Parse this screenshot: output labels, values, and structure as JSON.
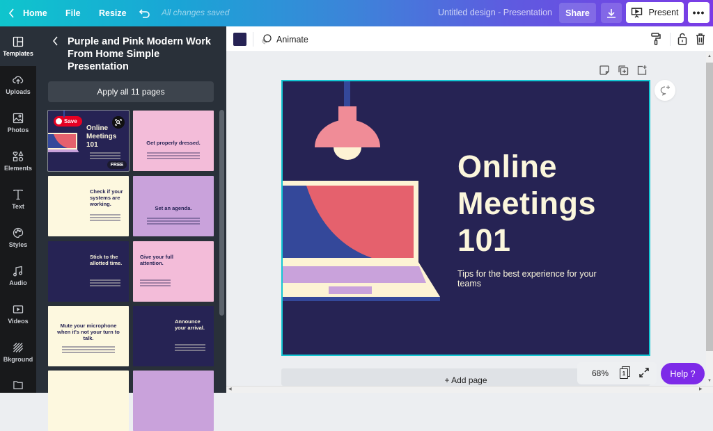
{
  "topbar": {
    "home_label": "Home",
    "file_label": "File",
    "resize_label": "Resize",
    "save_status": "All changes saved",
    "document_title": "Untitled design - Presentation",
    "share_label": "Share",
    "present_label": "Present",
    "more_label": "•••"
  },
  "rail": {
    "items": [
      {
        "label": "Templates",
        "icon": "templates-icon",
        "active": true
      },
      {
        "label": "Uploads",
        "icon": "cloud-upload-icon"
      },
      {
        "label": "Photos",
        "icon": "image-icon"
      },
      {
        "label": "Elements",
        "icon": "shapes-icon"
      },
      {
        "label": "Text",
        "icon": "text-icon"
      },
      {
        "label": "Styles",
        "icon": "palette-icon"
      },
      {
        "label": "Audio",
        "icon": "music-note-icon"
      },
      {
        "label": "Videos",
        "icon": "video-icon"
      },
      {
        "label": "Bkground",
        "icon": "background-pattern-icon"
      },
      {
        "label": "",
        "icon": "folder-icon"
      }
    ]
  },
  "panel": {
    "title": "Purple and Pink Modern Work From Home Simple Presentation",
    "apply_label": "Apply all 11 pages",
    "save_badge": "Save",
    "free_badge": "FREE",
    "thumbnails": [
      {
        "title": "Online Meetings 101",
        "bg": "#262354",
        "fg": "#fbf6dc"
      },
      {
        "title": "Get properly dressed.",
        "bg": "#f3bcd9",
        "fg": "#262354"
      },
      {
        "title": "Check if your systems are working.",
        "bg": "#fdf8df",
        "fg": "#262354"
      },
      {
        "title": "Set an agenda.",
        "bg": "#c9a2db",
        "fg": "#262354"
      },
      {
        "title": "Stick to the allotted time.",
        "bg": "#262354",
        "fg": "#fbf6dc"
      },
      {
        "title": "Give your full attention.",
        "bg": "#f3bcd9",
        "fg": "#262354"
      },
      {
        "title": "Mute your microphone when it's not your turn to talk.",
        "bg": "#fdf8df",
        "fg": "#262354"
      },
      {
        "title": "Announce your arrival.",
        "bg": "#262354",
        "fg": "#fbf6dc"
      },
      {
        "title": "",
        "bg": "#fdf8df",
        "fg": "#262354"
      },
      {
        "title": "",
        "bg": "#c9a2db",
        "fg": "#262354"
      }
    ]
  },
  "toolbar": {
    "color_swatch": "#262354",
    "animate_label": "Animate"
  },
  "slide": {
    "title_lines": [
      "Online",
      "Meetings",
      "101"
    ],
    "subtitle": "Tips for the best experience for your teams",
    "colors": {
      "bg": "#262354",
      "text": "#fbf6dc",
      "pink": "#f08c97",
      "red": "#e5616d",
      "blue": "#34489a",
      "lilac": "#c9a2db",
      "cream": "#fdf3d4"
    }
  },
  "footer": {
    "add_page_label": "+ Add page",
    "zoom_level": "68%",
    "page_count": "1",
    "help_label": "Help ?"
  }
}
